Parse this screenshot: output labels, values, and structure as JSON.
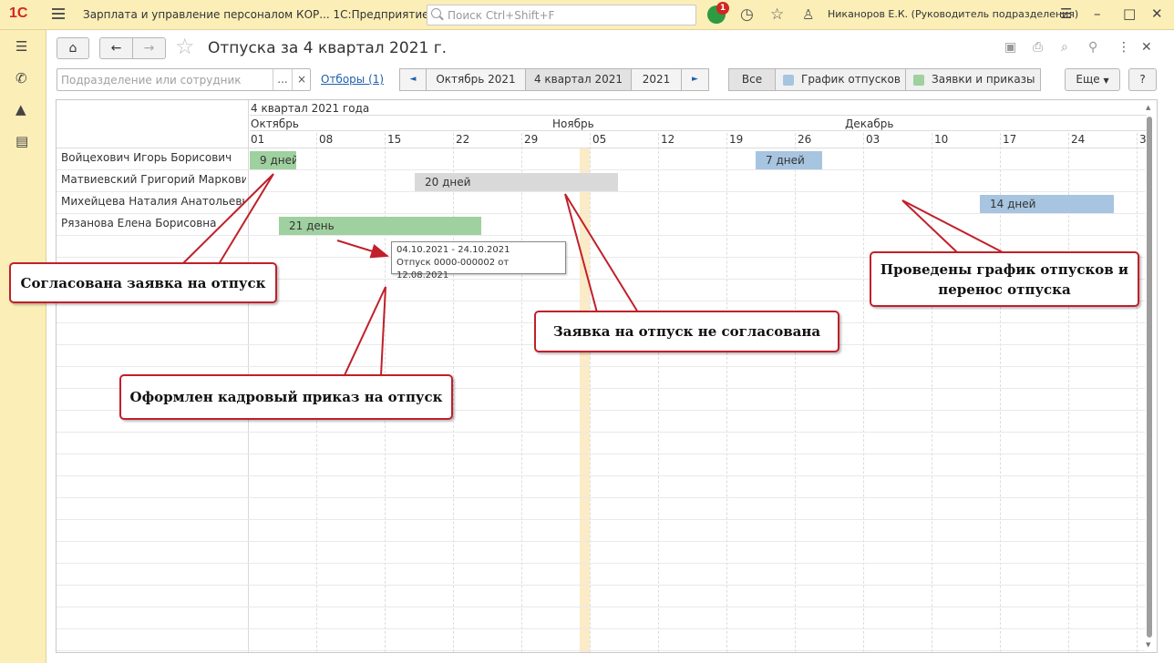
{
  "app": {
    "logo": "1С",
    "title": "Зарплата и управление персоналом КОР...  1С:Предприятие",
    "search_placeholder": "Поиск Ctrl+Shift+F",
    "notifications_count": "1",
    "user": "Никаноров Е.К. (Руководитель подразделения)"
  },
  "page": {
    "title": "Отпуска за 4 квартал 2021 г.",
    "filter_placeholder": "Подразделение или сотрудник",
    "filter_dropdown": "...",
    "filter_clear": "×",
    "selections_link": "Отборы (1)",
    "period_prev": "◄",
    "period_next": "►",
    "periods": [
      {
        "label": "Октябрь 2021",
        "selected": false
      },
      {
        "label": "4 квартал 2021",
        "selected": true
      },
      {
        "label": "2021",
        "selected": false
      }
    ],
    "legend": {
      "all": "Все",
      "schedule": "График отпусков",
      "orders": "Заявки и приказы",
      "schedule_color": "#a7c4e0",
      "orders_color": "#9fd09f"
    },
    "more_button": "Еще",
    "help_button": "?"
  },
  "gantt": {
    "period_header": "4 квартал 2021 года",
    "months": [
      "Октябрь",
      "Ноябрь",
      "Декабрь"
    ],
    "days": [
      "01",
      "08",
      "15",
      "22",
      "29",
      "05",
      "12",
      "19",
      "26",
      "03",
      "10",
      "17",
      "24",
      "3"
    ],
    "employees": [
      "Войцехович Игорь Борисович",
      "Матвиевский Григорий Маркович",
      "Михейцева Наталия Анатольевна",
      "Рязанова Елена Борисовна"
    ],
    "bars": [
      {
        "row": 0,
        "label": "9 дней",
        "status": "orders",
        "color": "#9fd09f"
      },
      {
        "row": 0,
        "label": "7 дней",
        "status": "schedule",
        "color": "#a7c4e0"
      },
      {
        "row": 1,
        "label": "20 дней",
        "status": "not_approved",
        "color": "#d9d9d9"
      },
      {
        "row": 2,
        "label": "14 дней",
        "status": "schedule",
        "color": "#a7c4e0"
      },
      {
        "row": 3,
        "label": "21 день",
        "status": "orders",
        "color": "#9fd09f"
      }
    ],
    "tooltip": {
      "dates": "04.10.2021 - 24.10.2021",
      "document": "Отпуск 0000-000002 от 12.08.2021"
    }
  },
  "callouts": {
    "approved": "Согласована заявка на отпуск",
    "order": "Оформлен кадровый приказ на отпуск",
    "not_approved": "Заявка на отпуск не согласована",
    "schedule_line1": "Проведены график отпусков и",
    "schedule_line2": "перенос отпуска"
  }
}
